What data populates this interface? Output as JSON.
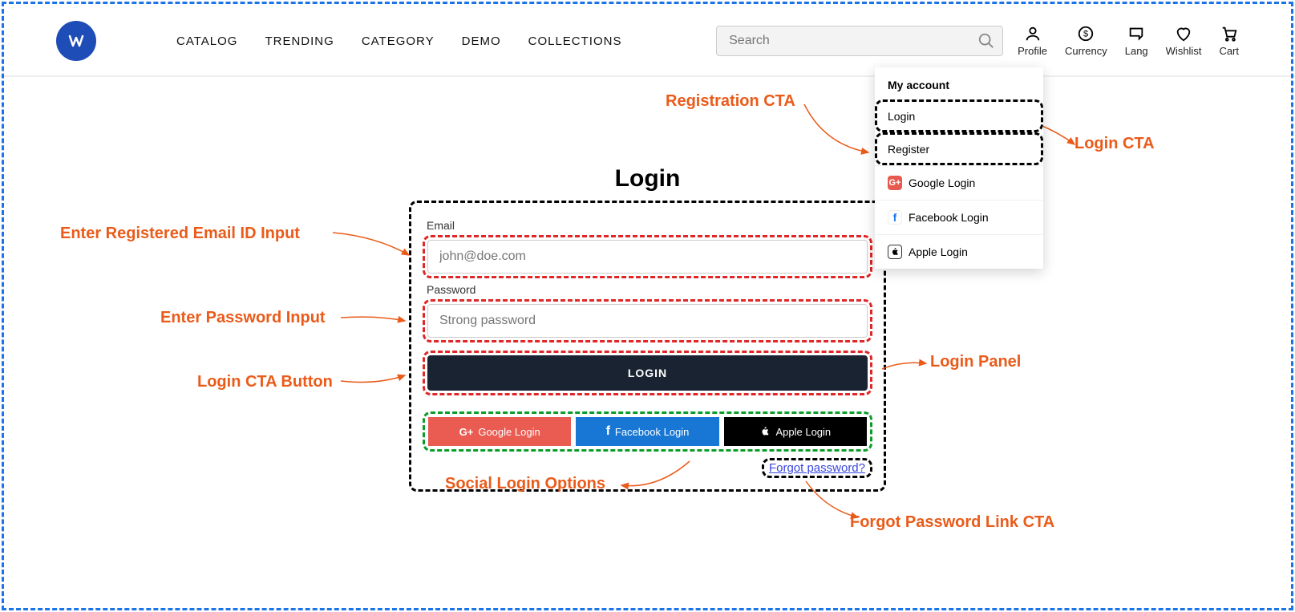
{
  "header": {
    "nav": {
      "catalog": "CATALOG",
      "trending": "TRENDING",
      "category": "CATEGORY",
      "demo": "DEMO",
      "collections": "COLLECTIONS"
    },
    "search_placeholder": "Search",
    "icons": {
      "profile": "Profile",
      "currency": "Currency",
      "lang": "Lang",
      "wishlist": "Wishlist",
      "cart": "Cart"
    }
  },
  "dropdown": {
    "title": "My account",
    "login": "Login",
    "register": "Register",
    "google": "Google Login",
    "facebook": "Facebook Login",
    "apple": "Apple Login"
  },
  "login": {
    "title": "Login",
    "email_label": "Email",
    "email_placeholder": "john@doe.com",
    "password_label": "Password",
    "password_placeholder": "Strong password",
    "button": "LOGIN",
    "google_btn": "Google Login",
    "facebook_btn": "Facebook Login",
    "apple_btn": "Apple Login",
    "forgot": "Forgot password?"
  },
  "callouts": {
    "registration_cta": "Registration CTA",
    "login_cta": "Login CTA",
    "email_input": "Enter Registered Email ID Input",
    "password_input": "Enter Password Input",
    "login_button": "Login CTA Button",
    "social_options": "Social Login Options",
    "login_panel": "Login Panel",
    "forgot_cta": "Forgot Password Link CTA"
  }
}
